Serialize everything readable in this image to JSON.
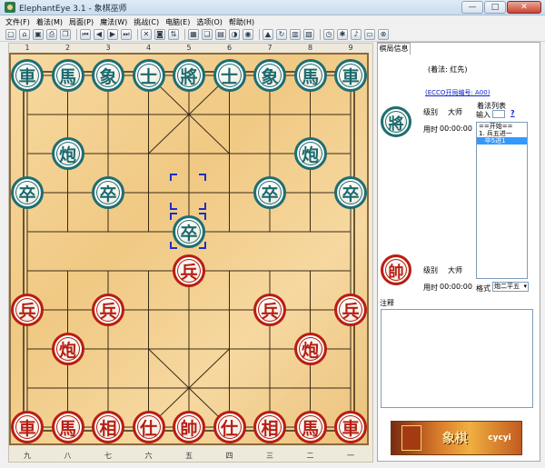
{
  "window": {
    "title": "ElephantEye 3.1 - 象棋巫师",
    "min": "—",
    "max": "□",
    "close": "✕"
  },
  "menu": [
    "文件(F)",
    "着法(M)",
    "局面(P)",
    "魔法(W)",
    "挑战(C)",
    "电脑(E)",
    "选项(O)",
    "帮助(H)"
  ],
  "toolbar_icons": [
    "new-file-icon",
    "open-folder-icon",
    "save-icon",
    "print-icon",
    "copy-icon",
    "first-move-icon",
    "prev-move-icon",
    "next-move-icon",
    "last-move-icon",
    "delete-icon",
    "camera-icon",
    "flip-board-icon",
    "board-edit-icon",
    "book-icon",
    "chart-icon",
    "color-icon",
    "eye-icon",
    "lock-icon",
    "refresh-icon",
    "film-icon",
    "image-icon",
    "clock-icon",
    "settings-icon",
    "sound-icon",
    "screen-icon",
    "stop-icon"
  ],
  "board": {
    "top_files": [
      "1",
      "2",
      "3",
      "4",
      "5",
      "6",
      "7",
      "8",
      "9"
    ],
    "bottom_files": [
      "九",
      "八",
      "七",
      "六",
      "五",
      "四",
      "三",
      "二",
      "一"
    ],
    "black_pieces": [
      {
        "c": 0,
        "r": 0,
        "t": "車"
      },
      {
        "c": 1,
        "r": 0,
        "t": "馬"
      },
      {
        "c": 2,
        "r": 0,
        "t": "象"
      },
      {
        "c": 3,
        "r": 0,
        "t": "士"
      },
      {
        "c": 4,
        "r": 0,
        "t": "將"
      },
      {
        "c": 5,
        "r": 0,
        "t": "士"
      },
      {
        "c": 6,
        "r": 0,
        "t": "象"
      },
      {
        "c": 7,
        "r": 0,
        "t": "馬"
      },
      {
        "c": 8,
        "r": 0,
        "t": "車"
      },
      {
        "c": 1,
        "r": 2,
        "t": "炮"
      },
      {
        "c": 7,
        "r": 2,
        "t": "炮"
      },
      {
        "c": 0,
        "r": 3,
        "t": "卒"
      },
      {
        "c": 2,
        "r": 3,
        "t": "卒"
      },
      {
        "c": 6,
        "r": 3,
        "t": "卒"
      },
      {
        "c": 8,
        "r": 3,
        "t": "卒"
      },
      {
        "c": 4,
        "r": 4,
        "t": "卒"
      }
    ],
    "red_pieces": [
      {
        "c": 4,
        "r": 5,
        "t": "兵"
      },
      {
        "c": 0,
        "r": 6,
        "t": "兵"
      },
      {
        "c": 2,
        "r": 6,
        "t": "兵"
      },
      {
        "c": 6,
        "r": 6,
        "t": "兵"
      },
      {
        "c": 8,
        "r": 6,
        "t": "兵"
      },
      {
        "c": 1,
        "r": 7,
        "t": "炮"
      },
      {
        "c": 7,
        "r": 7,
        "t": "炮"
      },
      {
        "c": 0,
        "r": 9,
        "t": "車"
      },
      {
        "c": 1,
        "r": 9,
        "t": "馬"
      },
      {
        "c": 2,
        "r": 9,
        "t": "相"
      },
      {
        "c": 3,
        "r": 9,
        "t": "仕"
      },
      {
        "c": 4,
        "r": 9,
        "t": "帥"
      },
      {
        "c": 5,
        "r": 9,
        "t": "仕"
      },
      {
        "c": 6,
        "r": 9,
        "t": "相"
      },
      {
        "c": 7,
        "r": 9,
        "t": "馬"
      },
      {
        "c": 8,
        "r": 9,
        "t": "車"
      }
    ]
  },
  "panel": {
    "tab": "棋局信息",
    "moves_header": "(着法: 红先)",
    "eco": "(ECCO开局编号: A00)",
    "black_player": {
      "glyph": "將",
      "level_label": "级别",
      "level": "大师",
      "time_label": "用时",
      "time": "00:00:00"
    },
    "red_player": {
      "glyph": "帥",
      "level_label": "级别",
      "level": "大师",
      "time_label": "用时",
      "time": "00:00:00"
    },
    "move_list": {
      "title": "着法列表",
      "input_label": "输入",
      "help": "?",
      "items": [
        "==开始==",
        "1. 兵五进一",
        "   卒5进1"
      ],
      "selected": 2
    },
    "format_label": "格式",
    "format_value": "炮二平五",
    "notes_label": "注释",
    "ad": {
      "text1": "象棋",
      "text2": "cycyi"
    }
  }
}
